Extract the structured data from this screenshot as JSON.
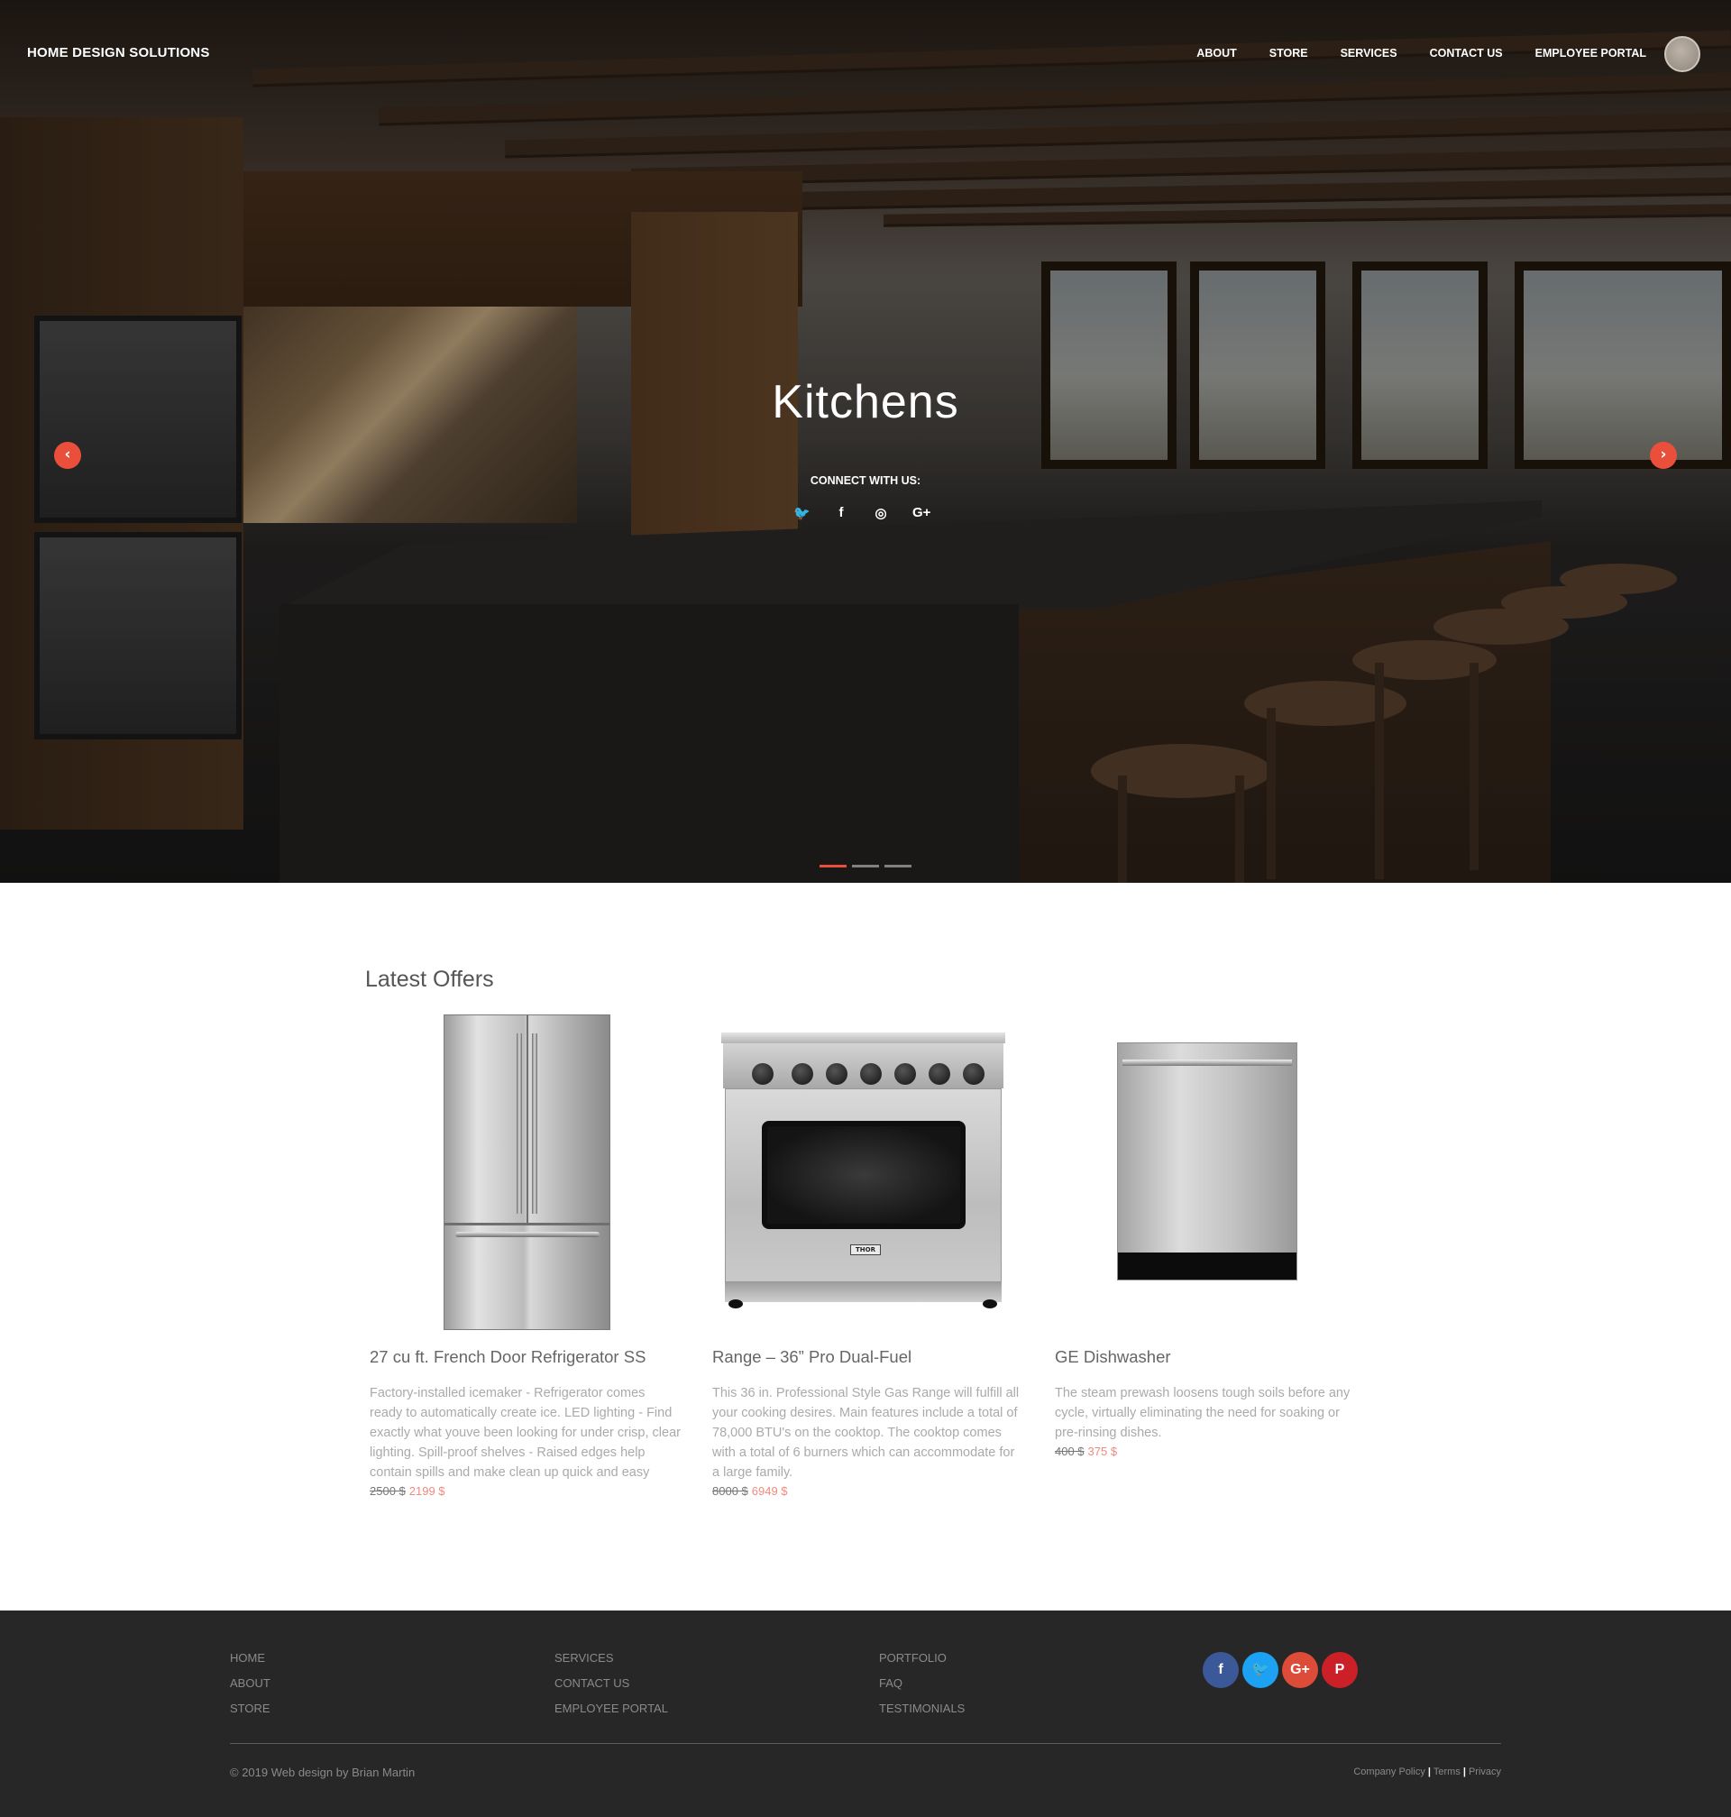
{
  "header": {
    "brand": "HOME DESIGN SOLUTIONS",
    "nav": [
      "ABOUT",
      "STORE",
      "SERVICES",
      "CONTACT US",
      "EMPLOYEE PORTAL"
    ]
  },
  "hero": {
    "title": "Kitchens",
    "connect_label": "CONNECT WITH US:",
    "social_icons": [
      "twitter-icon",
      "facebook-icon",
      "instagram-icon",
      "google-plus-icon"
    ],
    "social_glyphs": [
      "🐦",
      "f",
      "◎",
      "G+"
    ],
    "prev_glyph": "‹",
    "next_glyph": "›",
    "slide_index": 1,
    "slide_count": 3,
    "accent_color": "#ea4f3b"
  },
  "offers": {
    "title": "Latest Offers",
    "products": [
      {
        "name": "27 cu ft. French Door Refrigerator SS",
        "description": "Factory-installed icemaker - Refrigerator comes ready to automatically create ice. LED lighting - Find exactly what youve been looking for under crisp, clear lighting. Spill-proof shelves - Raised edges help contain spills and make clean up quick and easy",
        "old_price": "2500 $",
        "new_price": "2199 $"
      },
      {
        "name": "Range – 36” Pro Dual-Fuel",
        "description": "This 36 in. Professional Style Gas Range will fulfill all your cooking desires. Main features include a total of 78,000 BTU's on the cooktop. The cooktop comes with a total of 6 burners which can accommodate for a large family.",
        "old_price": "8000 $",
        "new_price": "6949 $",
        "brand_badge": "THOR"
      },
      {
        "name": "GE Dishwasher",
        "description": "The steam prewash loosens tough soils before any cycle, virtually eliminating the need for soaking or pre-rinsing dishes.",
        "old_price": "400 $",
        "new_price": "375 $"
      }
    ]
  },
  "footer": {
    "col1": [
      "HOME",
      "ABOUT",
      "STORE"
    ],
    "col2": [
      "SERVICES",
      "CONTACT US",
      "EMPLOYEE PORTAL"
    ],
    "col3": [
      "PORTFOLIO",
      "FAQ",
      "TESTIMONIALS"
    ],
    "social": [
      {
        "icon": "facebook-icon",
        "glyph": "f",
        "color": "#3b5998"
      },
      {
        "icon": "twitter-icon",
        "glyph": "🐦",
        "color": "#1da1f2"
      },
      {
        "icon": "google-plus-icon",
        "glyph": "G+",
        "color": "#dd4b39"
      },
      {
        "icon": "pinterest-icon",
        "glyph": "P",
        "color": "#cb2027"
      }
    ],
    "copyright": "© 2019 Web design by Brian Martin",
    "legal": [
      "Company Policy",
      "Terms",
      "Privacy"
    ]
  }
}
